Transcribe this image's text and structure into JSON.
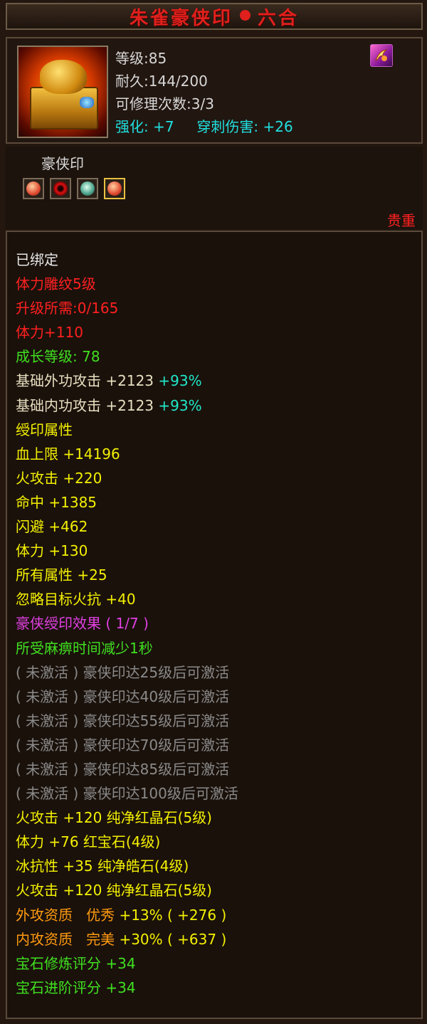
{
  "title": {
    "part1": "朱雀豪侠印",
    "part2": "六合"
  },
  "header": {
    "level_label": "等级",
    "level_value": ":85",
    "durability_label": "耐久",
    "durability_value": ":144/200",
    "repair_label": "可修理次数",
    "repair_value": ":3/3",
    "enhance_label": "强化:",
    "enhance_value": "+7",
    "pierce_label": "穿刺伤害:",
    "pierce_value": "+26",
    "corner_icon": "bound-item-icon"
  },
  "set": {
    "name": "豪侠印",
    "icons": [
      "peach-orb-icon",
      "red-swirl-icon",
      "teal-ornament-icon",
      "peach-orb-icon"
    ],
    "rarity": "贵重"
  },
  "details": {
    "bound": "已绑定",
    "engrave": "体力雕纹5级",
    "upgrade_need": "升级所需:0/165",
    "stamina": "体力+110",
    "growth_label": "成长等级:",
    "growth_value": "78",
    "base_ext_label": "基础外功攻击",
    "base_ext_value": "+2123",
    "base_ext_pct": "+93%",
    "base_int_label": "基础内功攻击",
    "base_int_value": "+2123",
    "base_int_pct": "+93%",
    "seal_attr_title": "绶印属性",
    "attrs": [
      {
        "label": "血上限",
        "value": "+14196"
      },
      {
        "label": "火攻击",
        "value": "+220"
      },
      {
        "label": "命中",
        "value": "+1385"
      },
      {
        "label": "闪避",
        "value": "+462"
      },
      {
        "label": "体力",
        "value": "+130"
      },
      {
        "label": "所有属性",
        "value": "+25"
      },
      {
        "label": "忽略目标火抗",
        "value": "+40"
      }
    ],
    "effect_title": "豪侠绶印效果",
    "effect_count": "( 1/7 )",
    "effect_active": "所受麻痹时间减少1秒",
    "inactive": [
      "( 未激活 ) 豪侠印达25级后可激活",
      "( 未激活 ) 豪侠印达40级后可激活",
      "( 未激活 ) 豪侠印达55级后可激活",
      "( 未激活 ) 豪侠印达70级后可激活",
      "( 未激活 ) 豪侠印达85级后可激活",
      "( 未激活 ) 豪侠印达100级后可激活"
    ],
    "gems": [
      {
        "label": "火攻击",
        "value": "+120",
        "gem": "纯净红晶石(5级)"
      },
      {
        "label": "体力",
        "value": "+76",
        "gem": "红宝石(4级)"
      },
      {
        "label": "冰抗性",
        "value": "+35",
        "gem": "纯净皓石(4级)"
      },
      {
        "label": "火攻击",
        "value": "+120",
        "gem": "纯净红晶石(5级)"
      }
    ],
    "ext_quality": {
      "label": "外攻资质",
      "grade": "优秀",
      "pct": "+13%",
      "bonus": "( +276 )"
    },
    "int_quality": {
      "label": "内攻资质",
      "grade": "完美",
      "pct": "+30%",
      "bonus": "( +637 )"
    },
    "gem_refine_label": "宝石修炼评分",
    "gem_refine_value": "+34",
    "gem_advance_label": "宝石进阶评分",
    "gem_advance_value": "+34"
  }
}
